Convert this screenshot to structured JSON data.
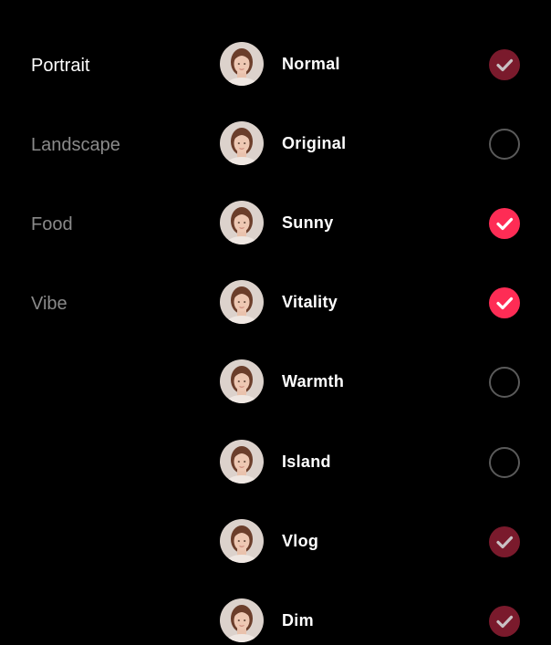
{
  "categories": [
    {
      "label": "Portrait",
      "active": true
    },
    {
      "label": "Landscape",
      "active": false
    },
    {
      "label": "Food",
      "active": false
    },
    {
      "label": "Vibe",
      "active": false
    }
  ],
  "filters": [
    {
      "label": "Normal",
      "state": "checked-dim",
      "icon": "portrait-thumbnail"
    },
    {
      "label": "Original",
      "state": "unchecked",
      "icon": "portrait-thumbnail"
    },
    {
      "label": "Sunny",
      "state": "checked",
      "icon": "portrait-thumbnail"
    },
    {
      "label": "Vitality",
      "state": "checked",
      "icon": "portrait-thumbnail"
    },
    {
      "label": "Warmth",
      "state": "unchecked",
      "icon": "portrait-thumbnail"
    },
    {
      "label": "Island",
      "state": "unchecked",
      "icon": "portrait-thumbnail"
    },
    {
      "label": "Vlog",
      "state": "checked-dim",
      "icon": "portrait-thumbnail"
    },
    {
      "label": "Dim",
      "state": "checked-dim",
      "icon": "portrait-thumbnail"
    }
  ],
  "colors": {
    "background": "#000000",
    "category_active": "#ffffff",
    "category_inactive": "#8a8a8a",
    "check_active": "#fe2c55",
    "check_dim": "#7a1a2c",
    "check_dim_mark": "#c9c0c3",
    "unchecked_ring": "#5a5a5a"
  }
}
